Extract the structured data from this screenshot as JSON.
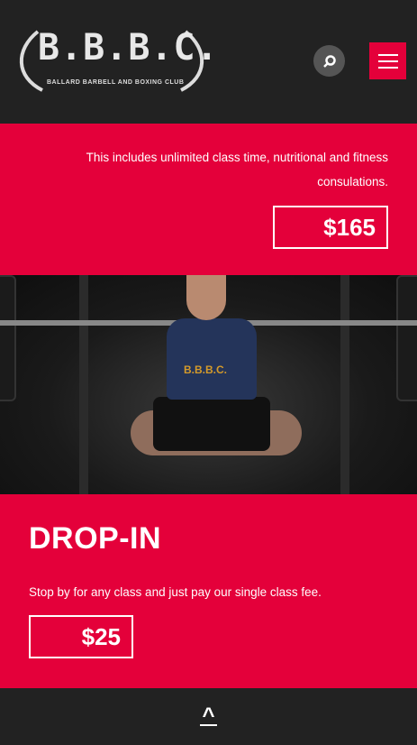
{
  "header": {
    "logo_text": "B.B.B.C.",
    "logo_subtitle": "BALLARD BARBELL AND BOXING CLUB",
    "search_icon": "search-icon",
    "menu_icon": "hamburger-icon"
  },
  "plan1": {
    "description": "This includes unlimited class time, nutritional and fitness consulations.",
    "price": "$165"
  },
  "dropin": {
    "title": "DROP-IN",
    "description": "Stop by for any class and just pay our single class fee.",
    "price": "$25"
  },
  "photo": {
    "shirt_text": "B.B.B.C."
  },
  "footer": {
    "back_to_top": "^"
  },
  "colors": {
    "accent": "#e4003a",
    "dark": "#222222"
  }
}
